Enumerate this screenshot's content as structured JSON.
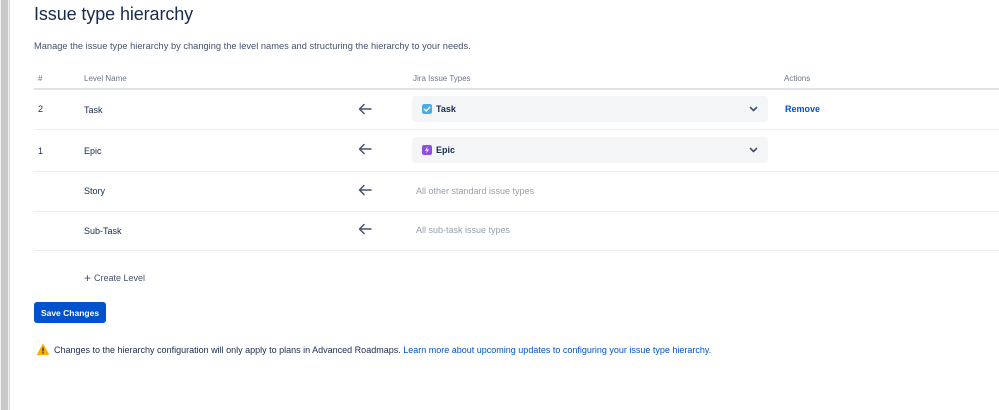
{
  "page": {
    "title": "Issue type hierarchy",
    "description": "Manage the issue type hierarchy by changing the level names and structuring the hierarchy to your needs."
  },
  "table": {
    "headers": {
      "number": "#",
      "level_name": "Level Name",
      "jira_issue_types": "Jira Issue Types",
      "actions": "Actions"
    },
    "rows": [
      {
        "number": "2",
        "level_name": "Task",
        "issue_type": {
          "kind": "select",
          "label": "Task",
          "icon": "task-checkbox-icon",
          "icon_color": "#4BADE8"
        },
        "action": "Remove"
      },
      {
        "number": "1",
        "level_name": "Epic",
        "issue_type": {
          "kind": "select",
          "label": "Epic",
          "icon": "epic-lightning-icon",
          "icon_color": "#904EE2"
        },
        "action": ""
      },
      {
        "number": "",
        "level_name": "Story",
        "issue_type": {
          "kind": "text",
          "label": "All other standard issue types"
        },
        "action": ""
      },
      {
        "number": "",
        "level_name": "Sub-Task",
        "issue_type": {
          "kind": "text",
          "label": "All sub-task issue types"
        },
        "action": ""
      }
    ]
  },
  "create_level_label": "Create Level",
  "save_button_label": "Save Changes",
  "notice": {
    "text": "Changes to the hierarchy configuration will only apply to plans in Advanced Roadmaps.",
    "link_text": "Learn more about upcoming updates to configuring your issue type hierarchy.",
    "icon": "warning-icon",
    "icon_color": "#FFAB00"
  },
  "colors": {
    "primary": "#0052CC",
    "text": "#172B4D",
    "muted": "#97A0AF"
  }
}
